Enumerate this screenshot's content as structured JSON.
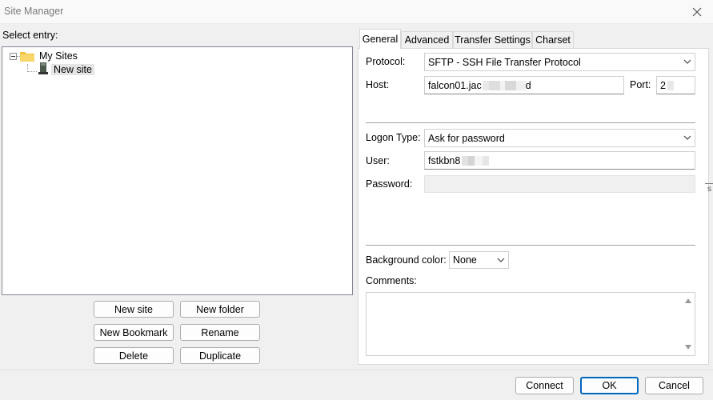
{
  "window": {
    "title": "Site Manager"
  },
  "left": {
    "select_entry_label": "Select entry:",
    "tree": {
      "root_label": "My Sites",
      "site_label": "New site"
    },
    "buttons": {
      "new_site": "New site",
      "new_folder": "New folder",
      "new_bookmark": "New Bookmark",
      "rename": "Rename",
      "delete": "Delete",
      "duplicate": "Duplicate"
    }
  },
  "tabs": [
    {
      "label": "General"
    },
    {
      "label": "Advanced"
    },
    {
      "label": "Transfer Settings"
    },
    {
      "label": "Charset"
    }
  ],
  "general": {
    "protocol_label": "Protocol:",
    "protocol_value": "SFTP - SSH File Transfer Protocol",
    "host_label": "Host:",
    "host_value_prefix": "falcon01.jac",
    "host_value_suffix": "d",
    "port_label": "Port:",
    "port_value": "2",
    "logon_type_label": "Logon Type:",
    "logon_type_value": "Ask for password",
    "user_label": "User:",
    "user_value_prefix": "fstkbn8",
    "password_label": "Password:",
    "background_color_label": "Background color:",
    "background_color_value": "None",
    "comments_label": "Comments:"
  },
  "footer": {
    "connect": "Connect",
    "ok": "OK",
    "cancel": "Cancel"
  },
  "edge_fragment": "s",
  "icons": {
    "close": "close-icon",
    "folder": "folder-icon",
    "site": "server-icon",
    "dropdown": "chevron-down-icon",
    "scroll_up": "scroll-up-icon",
    "scroll_down": "scroll-down-icon"
  },
  "colors": {
    "accent": "#0067c0",
    "folder": "#f3c13a",
    "selection": "#e5e5e5"
  }
}
